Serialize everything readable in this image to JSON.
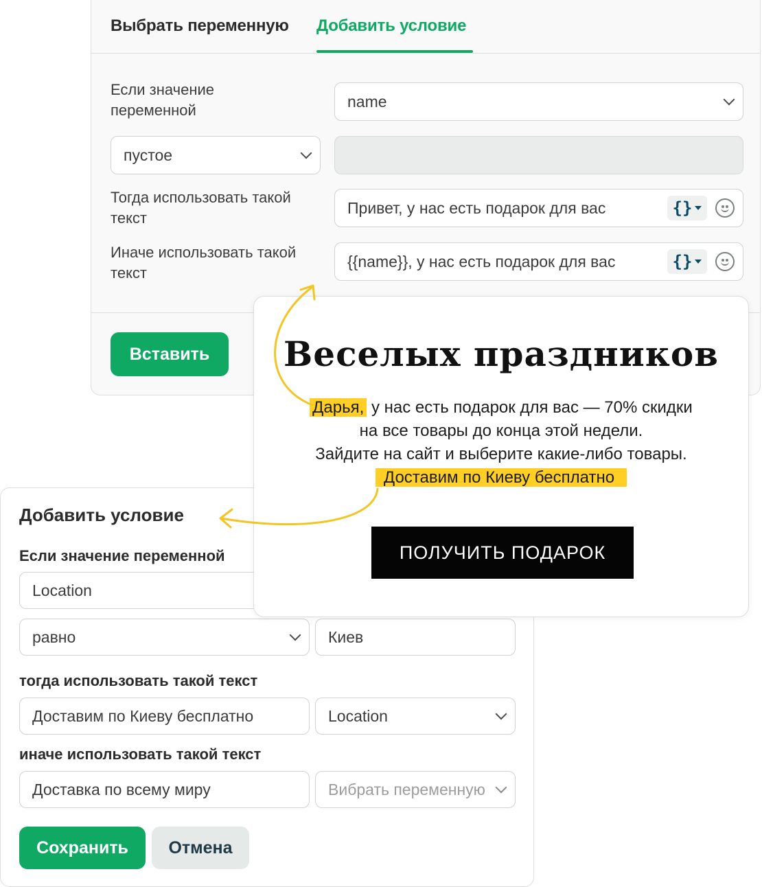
{
  "condition_panel": {
    "tabs": [
      {
        "label": "Выбрать переменную"
      },
      {
        "label": "Добавить условие"
      }
    ],
    "if_label": "Если значение переменной",
    "variable_value": "name",
    "operator_value": "пустое",
    "compare_value": "",
    "then_label": "Тогда использовать такой текст",
    "then_value": "Привет, у нас есть подарок для вас",
    "else_label": "Иначе использовать такой текст",
    "else_value": "{{name}}, у нас есть подарок для вас",
    "variable_icon": "{}",
    "insert_button": "Вставить"
  },
  "preview": {
    "title": "Веселых праздников",
    "name_highlight": "Дарья,",
    "line1_rest": " у нас есть подарок для вас — 70% скидки",
    "line2": "на все товары до конца этой недели.",
    "line3": "Зайдите на сайт и выберите какие-либо товары.",
    "delivery_highlight": "Доставим по Киеву бесплатно",
    "cta_button": "ПОЛУЧИТЬ ПОДАРОК",
    "highlight_color": "#ffcf26"
  },
  "add_condition_panel": {
    "title": "Добавить условие",
    "if_label": "Если значение переменной",
    "variable_value": "Location",
    "operator_value": "равно",
    "compare_value": "Киев",
    "then_label": "тогда использовать такой текст",
    "then_value": "Доставим по Киеву бесплатно",
    "then_variable": "Location",
    "else_label": "иначе использовать такой текст",
    "else_value": "Доставка по всему миру",
    "else_variable_placeholder": "Вибрать переменную",
    "save_button": "Сохранить",
    "cancel_button": "Отмена"
  },
  "colors": {
    "accent_green": "#10a964",
    "arrow_yellow": "#f2c522"
  }
}
